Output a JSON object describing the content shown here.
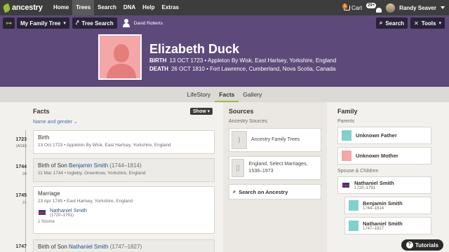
{
  "nav": {
    "brand": "ancestry",
    "items": [
      "Home",
      "Trees",
      "Search",
      "DNA",
      "Help",
      "Extras"
    ],
    "active": "Trees",
    "cart_label": "Cart",
    "cart_count": "1",
    "messages_count": "29+",
    "username": "Randy Seaver"
  },
  "treebar": {
    "tree_label": "My Family Tree",
    "tree_search": "Tree Search",
    "home_person": "David Roberts",
    "search": "Search",
    "tools": "Tools"
  },
  "person": {
    "name": "Elizabeth Duck",
    "birth_label": "BIRTH",
    "birth_value": "13 OCT 1723 • Appleton By Wisk, East Harlsey, Yorkshire, England",
    "death_label": "DEATH",
    "death_value": "26 OCT 1810 • Fort Lawrence, Cumberland, Nova Scotia, Canada"
  },
  "tabs": [
    "LifeStory",
    "Facts",
    "Gallery"
  ],
  "active_tab": "Facts",
  "facts": {
    "title": "Facts",
    "show_label": "Show",
    "filter": "Name and gender",
    "events": [
      {
        "year": "1723",
        "age": "(AGE)",
        "title": "Birth",
        "sub": "13 Oct 1723 • Appleton By Wisk, East Harlsey, Yorkshire, England"
      },
      {
        "year": "1744",
        "age": "20",
        "title_prefix": "Birth of Son ",
        "title_link": "Benjamin Smith",
        "title_suffix": " (1744–1814)",
        "sub": "11 Mar 1744 • Ingleby, Greenhow, Yorkshire, England"
      },
      {
        "year": "1745",
        "age": "21",
        "title": "Marriage",
        "sub": "23 Apr 1745 • East Harlsey, Yorkshire, England",
        "spouse": "Nathaniel Smith",
        "spouse_years": "(1720–1791)",
        "sources": "1 Source"
      },
      {
        "year": "1747",
        "age": "",
        "title_prefix": "Birth of Son ",
        "title_link": "Nathaniel Smith",
        "title_suffix": " (1747–1827)"
      }
    ]
  },
  "sources": {
    "title": "Sources",
    "subtitle": "Ancestry Sources",
    "items": [
      "Ancestry Family Trees",
      "England, Select Marriages, 1538–1973"
    ],
    "search_label": "Search on Ancestry"
  },
  "family": {
    "title": "Family",
    "parents_label": "Parents",
    "father": "Unknown Father",
    "mother": "Unknown Mother",
    "spouse_label": "Spouse & Children",
    "spouse": {
      "name": "Nathaniel Smith",
      "years": "1720–1791"
    },
    "children": [
      {
        "name": "Benjamin Smith",
        "years": "1744–1814"
      },
      {
        "name": "Nathaniel Smith",
        "years": "1747–1827"
      }
    ]
  },
  "tutorials": "Tutorials"
}
